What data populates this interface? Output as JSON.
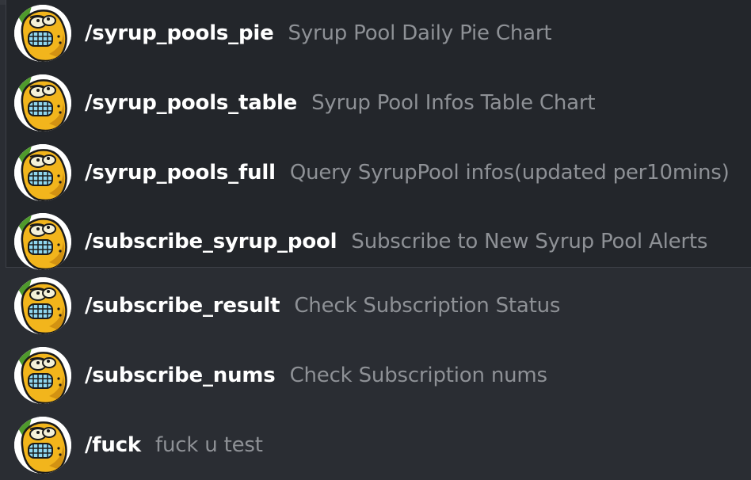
{
  "commands": [
    {
      "command": "/syrup_pools_pie",
      "description": "Syrup Pool Daily Pie Chart",
      "icon": "bender-robot-avatar-icon"
    },
    {
      "command": "/syrup_pools_table",
      "description": "Syrup Pool Infos Table Chart",
      "icon": "bender-robot-avatar-icon"
    },
    {
      "command": "/syrup_pools_full",
      "description": "Query SyrupPool infos(updated per10mins)",
      "icon": "bender-robot-avatar-icon"
    },
    {
      "command": "/subscribe_syrup_pool",
      "description": "Subscribe to New Syrup Pool Alerts",
      "icon": "bender-robot-avatar-icon"
    },
    {
      "command": "/subscribe_result",
      "description": "Check Subscription Status",
      "icon": "bender-robot-avatar-icon"
    },
    {
      "command": "/subscribe_nums",
      "description": "Check Subscription nums",
      "icon": "bender-robot-avatar-icon"
    },
    {
      "command": "/fuck",
      "description": "fuck u test",
      "icon": "bender-robot-avatar-icon"
    }
  ],
  "colors": {
    "background": "#2a2d33",
    "popup_background": "#23262b",
    "command_text": "#ffffff",
    "description_text": "#8e9196",
    "avatar_face": "#f2b51c",
    "avatar_outline": "#1a1a1a"
  }
}
